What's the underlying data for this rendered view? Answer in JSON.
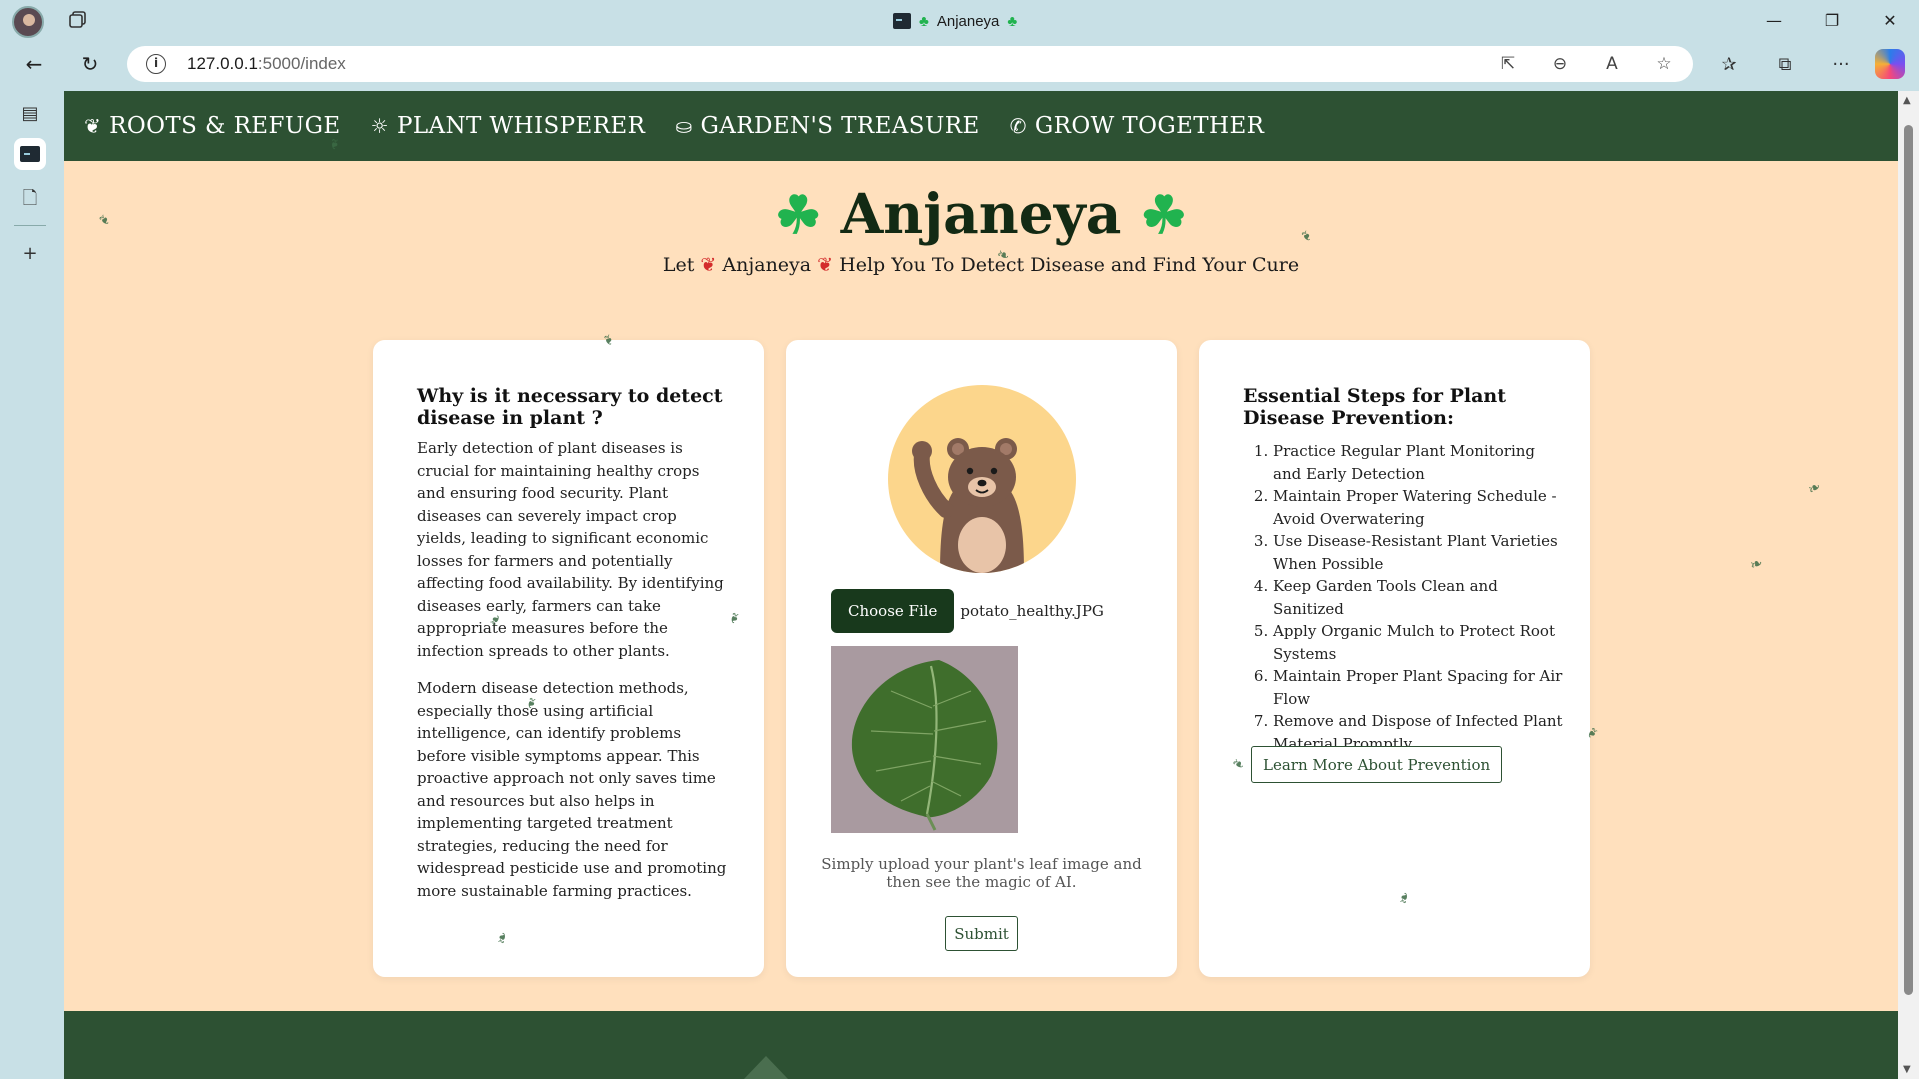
{
  "browser": {
    "tab_title": "Anjaneya",
    "tab_title_prefix_icon": "clover",
    "url_host": "127.0.0.1",
    "url_path": ":5000/index",
    "window_controls": [
      "minimize",
      "restore",
      "close"
    ]
  },
  "site": {
    "nav": [
      {
        "icon": "leaf-icon",
        "glyph": "❦",
        "label": "ROOTS & REFUGE"
      },
      {
        "icon": "lightbulb-icon",
        "glyph": "☼",
        "label": "PLANT WHISPERER"
      },
      {
        "icon": "bag-icon",
        "glyph": "⛀",
        "label": "GARDEN'S TREASURE"
      },
      {
        "icon": "phone-icon",
        "glyph": "✆",
        "label": "GROW TOGETHER"
      }
    ],
    "hero": {
      "title": "Anjaneya",
      "sub_let": "Let",
      "sub_name": "Anjaneya",
      "sub_rest": "Help You To Detect Disease and Find Your Cure"
    },
    "card1": {
      "heading": "Why is it necessary to detect disease in plant ?",
      "para1": "Early detection of plant diseases is crucial for maintaining healthy crops and ensuring food security. Plant diseases can severely impact crop yields, leading to significant economic losses for farmers and potentially affecting food availability. By identifying diseases early, farmers can take appropriate measures before the infection spreads to other plants.",
      "para2": "Modern disease detection methods, especially those using artificial intelligence, can identify problems before visible symptoms appear. This proactive approach not only saves time and resources but also helps in implementing targeted treatment strategies, reducing the need for widespread pesticide use and promoting more sustainable farming practices."
    },
    "card2": {
      "choose_label": "Choose File",
      "file_name": "potato_healthy.JPG",
      "hint": "Simply upload your plant's leaf image and then see the magic of AI.",
      "submit_label": "Submit"
    },
    "card3": {
      "heading": "Essential Steps for Plant Disease Prevention:",
      "steps": [
        "Practice Regular Plant Monitoring and Early Detection",
        "Maintain Proper Watering Schedule - Avoid Overwatering",
        "Use Disease-Resistant Plant Varieties When Possible",
        "Keep Garden Tools Clean and Sanitized",
        "Apply Organic Mulch to Protect Root Systems",
        "Maintain Proper Plant Spacing for Air Flow",
        "Remove and Dispose of Infected Plant Material Promptly"
      ],
      "learn_label": "Learn More About Prevention"
    }
  }
}
